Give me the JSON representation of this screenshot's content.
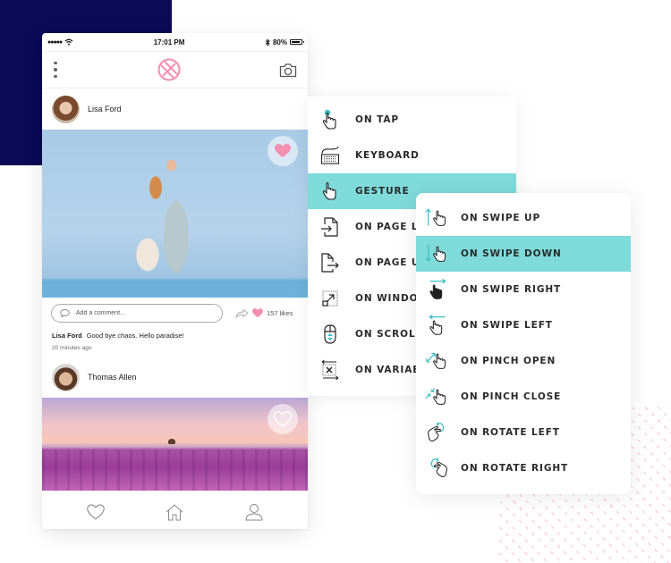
{
  "status_bar": {
    "signal": "●●●●●",
    "time": "17:01 PM",
    "battery": "80%"
  },
  "header": {
    "logo_icon": "ball-logo-icon",
    "menu_icon": "more-vertical-icon",
    "camera_icon": "camera-icon"
  },
  "posts": [
    {
      "author": "Lisa Ford",
      "liked": true,
      "comment_placeholder": "Add a comment...",
      "likes": "157 likes",
      "caption_author": "Lisa Ford",
      "caption_text": "Good bye chaos. Hello paradise!",
      "time_ago": "20 minutes ago"
    },
    {
      "author": "Thomas Allen",
      "liked": false
    }
  ],
  "tab_bar": {
    "items": [
      "heart-icon",
      "home-icon",
      "profile-icon"
    ]
  },
  "menu_main": {
    "items": [
      {
        "label": "ON TAP",
        "icon": "tap-icon",
        "active": false
      },
      {
        "label": "KEYBOARD",
        "icon": "keyboard-icon",
        "active": false
      },
      {
        "label": "GESTURE",
        "icon": "gesture-icon",
        "active": true
      },
      {
        "label": "ON PAGE LOAD",
        "icon": "page-load-icon",
        "active": false
      },
      {
        "label": "ON PAGE UNLOAD",
        "icon": "page-unload-icon",
        "active": false
      },
      {
        "label": "ON WINDOW SCROLL",
        "icon": "window-resize-icon",
        "active": false
      },
      {
        "label": "ON SCROLL",
        "icon": "scroll-mouse-icon",
        "active": false
      },
      {
        "label": "ON VARIABLE CHANGE",
        "icon": "variable-icon",
        "active": false
      }
    ]
  },
  "menu_gesture": {
    "items": [
      {
        "label": "ON SWIPE UP",
        "icon": "swipe-up-icon",
        "active": false
      },
      {
        "label": "ON SWIPE DOWN",
        "icon": "swipe-down-icon",
        "active": true
      },
      {
        "label": "ON SWIPE RIGHT",
        "icon": "swipe-right-icon",
        "active": false
      },
      {
        "label": "ON SWIPE LEFT",
        "icon": "swipe-left-icon",
        "active": false
      },
      {
        "label": "ON PINCH OPEN",
        "icon": "pinch-open-icon",
        "active": false
      },
      {
        "label": "ON PINCH CLOSE",
        "icon": "pinch-close-icon",
        "active": false
      },
      {
        "label": "ON ROTATE LEFT",
        "icon": "rotate-left-icon",
        "active": false
      },
      {
        "label": "ON ROTATE RIGHT",
        "icon": "rotate-right-icon",
        "active": false
      }
    ]
  },
  "colors": {
    "navy": "#0a0a55",
    "teal_active": "#7fdada",
    "teal_icon": "#3bbfc5",
    "pink": "#f48fb1"
  }
}
